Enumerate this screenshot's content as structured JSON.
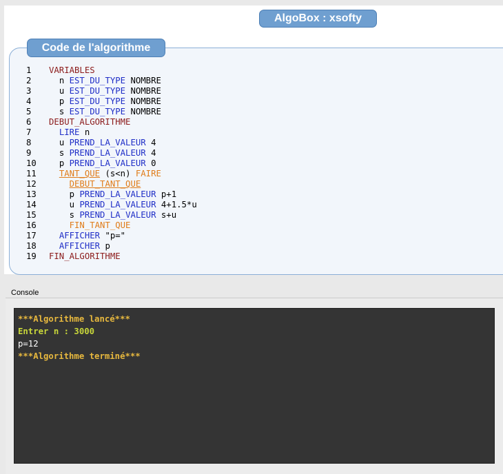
{
  "header": {
    "title": "AlgoBox : xsofty"
  },
  "code_panel": {
    "tab_label": "Code de l'algorithme",
    "lines": [
      {
        "num": "1",
        "indent": "",
        "tokens": [
          {
            "text": "VARIABLES",
            "style": "keyword"
          }
        ]
      },
      {
        "num": "2",
        "indent": "  ",
        "tokens": [
          {
            "text": "n ",
            "style": "normal"
          },
          {
            "text": "EST_DU_TYPE",
            "style": "blue"
          },
          {
            "text": " NOMBRE",
            "style": "normal"
          }
        ]
      },
      {
        "num": "3",
        "indent": "  ",
        "tokens": [
          {
            "text": "u ",
            "style": "normal"
          },
          {
            "text": "EST_DU_TYPE",
            "style": "blue"
          },
          {
            "text": " NOMBRE",
            "style": "normal"
          }
        ]
      },
      {
        "num": "4",
        "indent": "  ",
        "tokens": [
          {
            "text": "p ",
            "style": "normal"
          },
          {
            "text": "EST_DU_TYPE",
            "style": "blue"
          },
          {
            "text": " NOMBRE",
            "style": "normal"
          }
        ]
      },
      {
        "num": "5",
        "indent": "  ",
        "tokens": [
          {
            "text": "s ",
            "style": "normal"
          },
          {
            "text": "EST_DU_TYPE",
            "style": "blue"
          },
          {
            "text": " NOMBRE",
            "style": "normal"
          }
        ]
      },
      {
        "num": "6",
        "indent": "",
        "tokens": [
          {
            "text": "DEBUT_ALGORITHME",
            "style": "keyword"
          }
        ]
      },
      {
        "num": "7",
        "indent": "  ",
        "tokens": [
          {
            "text": "LIRE",
            "style": "blue"
          },
          {
            "text": " n",
            "style": "normal"
          }
        ]
      },
      {
        "num": "8",
        "indent": "  ",
        "tokens": [
          {
            "text": "u ",
            "style": "normal"
          },
          {
            "text": "PREND_LA_VALEUR",
            "style": "blue"
          },
          {
            "text": " 4",
            "style": "normal"
          }
        ]
      },
      {
        "num": "9",
        "indent": "  ",
        "tokens": [
          {
            "text": "s ",
            "style": "normal"
          },
          {
            "text": "PREND_LA_VALEUR",
            "style": "blue"
          },
          {
            "text": " 4",
            "style": "normal"
          }
        ]
      },
      {
        "num": "10",
        "indent": "  ",
        "tokens": [
          {
            "text": "p ",
            "style": "normal"
          },
          {
            "text": "PREND_LA_VALEUR",
            "style": "blue"
          },
          {
            "text": " 0",
            "style": "normal"
          }
        ]
      },
      {
        "num": "11",
        "indent": "  ",
        "tokens": [
          {
            "text": "TANT_QUE",
            "style": "orange-underline"
          },
          {
            "text": " (s<n) ",
            "style": "normal"
          },
          {
            "text": "FAIRE",
            "style": "orange"
          }
        ]
      },
      {
        "num": "12",
        "indent": "    ",
        "tokens": [
          {
            "text": "DEBUT_TANT_QUE",
            "style": "orange-underline"
          }
        ]
      },
      {
        "num": "13",
        "indent": "    ",
        "tokens": [
          {
            "text": "p ",
            "style": "normal"
          },
          {
            "text": "PREND_LA_VALEUR",
            "style": "blue"
          },
          {
            "text": " p+1",
            "style": "normal"
          }
        ]
      },
      {
        "num": "14",
        "indent": "    ",
        "tokens": [
          {
            "text": "u ",
            "style": "normal"
          },
          {
            "text": "PREND_LA_VALEUR",
            "style": "blue"
          },
          {
            "text": " 4+1.5*u",
            "style": "normal"
          }
        ]
      },
      {
        "num": "15",
        "indent": "    ",
        "tokens": [
          {
            "text": "s ",
            "style": "normal"
          },
          {
            "text": "PREND_LA_VALEUR",
            "style": "blue"
          },
          {
            "text": " s+u",
            "style": "normal"
          }
        ]
      },
      {
        "num": "16",
        "indent": "    ",
        "tokens": [
          {
            "text": "FIN_TANT_QUE",
            "style": "orange"
          }
        ]
      },
      {
        "num": "17",
        "indent": "  ",
        "tokens": [
          {
            "text": "AFFICHER",
            "style": "blue"
          },
          {
            "text": " \"p=\"",
            "style": "normal"
          }
        ]
      },
      {
        "num": "18",
        "indent": "  ",
        "tokens": [
          {
            "text": "AFFICHER",
            "style": "blue"
          },
          {
            "text": " p",
            "style": "normal"
          }
        ]
      },
      {
        "num": "19",
        "indent": "",
        "tokens": [
          {
            "text": "FIN_ALGORITHME",
            "style": "keyword"
          }
        ]
      }
    ]
  },
  "console": {
    "label": "Console",
    "lines": [
      {
        "text": "***Algorithme lancé***",
        "style": "yellow"
      },
      {
        "text": "Entrer n : 3000",
        "style": "green"
      },
      {
        "text": "p=12",
        "style": "white"
      },
      {
        "text": "***Algorithme terminé***",
        "style": "yellow"
      }
    ]
  },
  "colors": {
    "accent": "#6f9fd0",
    "keyword": "#8b1a1a",
    "instruction": "#1f2ec7",
    "loop": "#e07c19",
    "console_bg": "#343434"
  }
}
